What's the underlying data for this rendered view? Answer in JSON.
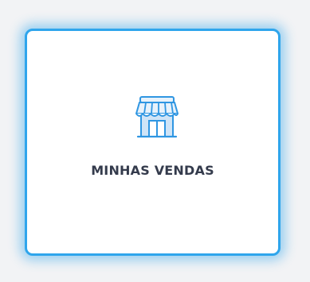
{
  "card": {
    "label": "MINHAS VENDAS",
    "icon": "store-icon"
  },
  "colors": {
    "accent": "#2ea5ec",
    "icon_outline": "#2f96e2",
    "icon_fill": "#cfe4f7",
    "text": "#343b4c",
    "background": "#f2f3f5"
  }
}
